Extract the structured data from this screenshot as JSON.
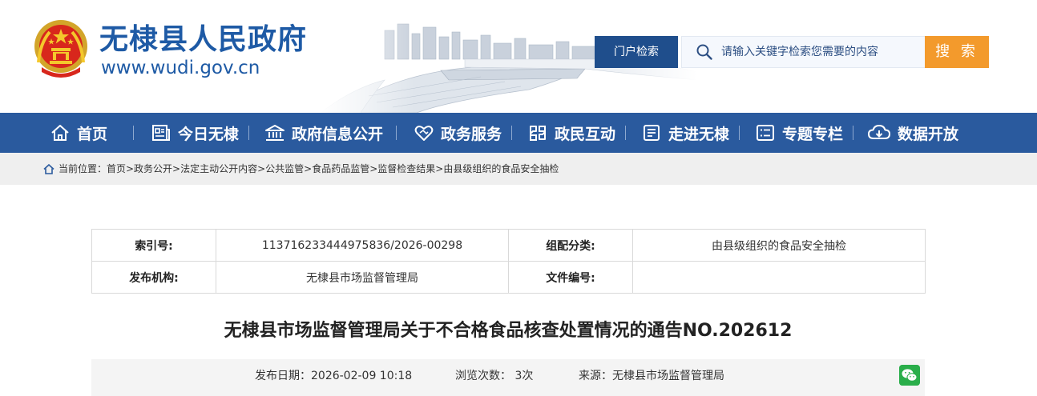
{
  "header": {
    "site_title": "无棣县人民政府",
    "site_url": "www.wudi.gov.cn",
    "portal_search_label": "门户检索",
    "search_placeholder": "请输入关键字检索您需要的内容",
    "search_button": "搜 索"
  },
  "nav": {
    "items": [
      {
        "label": "首页",
        "icon": "home-icon"
      },
      {
        "label": "今日无棣",
        "icon": "newspaper-icon"
      },
      {
        "label": "政府信息公开",
        "icon": "government-building-icon"
      },
      {
        "label": "政务服务",
        "icon": "handshake-heart-icon"
      },
      {
        "label": "政民互动",
        "icon": "interaction-icon"
      },
      {
        "label": "走进无棣",
        "icon": "document-list-icon"
      },
      {
        "label": "专题专栏",
        "icon": "list-icon"
      },
      {
        "label": "数据开放",
        "icon": "cloud-download-icon"
      }
    ]
  },
  "breadcrumb": {
    "text": "当前位置：首页>政务公开>法定主动公开内容>公共监管>食品药品监管>监督检查结果>由县级组织的食品安全抽检"
  },
  "info": {
    "index_label": "索引号:",
    "index_value": "11371623344497583​6/2026-00298",
    "category_label": "组配分类:",
    "category_value": "由县级组织的食品安全抽检",
    "publisher_label": "发布机构:",
    "publisher_value": "无棣县市场监督管理局",
    "doc_no_label": "文件编号:",
    "doc_no_value": ""
  },
  "article": {
    "title": "无棣县市场监督管理局关于不合格食品核查处置情况的通告NO.202612",
    "publish_date": "发布日期：2026-02-09 10:18",
    "views": "浏览次数： 3次",
    "source": "来源：无棣县市场监督管理局"
  },
  "colors": {
    "brand_blue": "#1e5aa5",
    "nav_blue": "#2a5a9e",
    "portal_blue": "#1f4e8c",
    "search_orange": "#f39a2c",
    "wechat_green": "#2aae4a"
  }
}
